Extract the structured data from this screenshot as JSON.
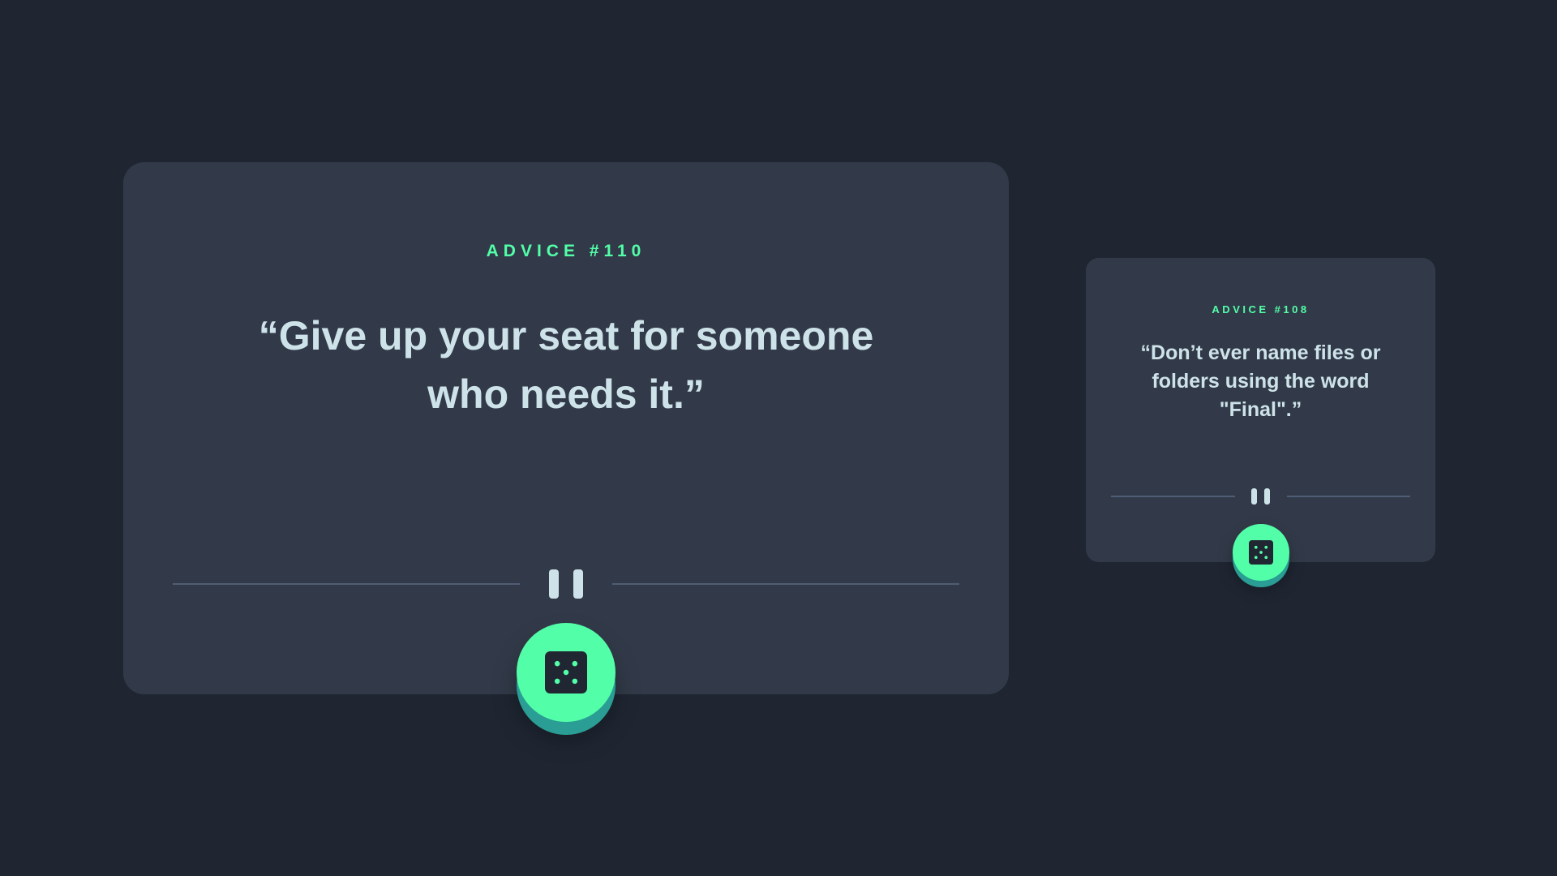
{
  "cards": [
    {
      "label": "ADVICE #110",
      "quote": "“Give up your seat for someone who needs it.”"
    },
    {
      "label": "ADVICE #108",
      "quote": "“Don’t ever name files or folders using the word \"Final\".”"
    }
  ],
  "icons": {
    "divider": "pause-icon",
    "button": "dice-icon"
  },
  "colors": {
    "background": "#1f2632",
    "card": "#323a49",
    "accent": "#52ffa8",
    "text": "#cee3e9",
    "divider_line": "#4f5d74"
  }
}
